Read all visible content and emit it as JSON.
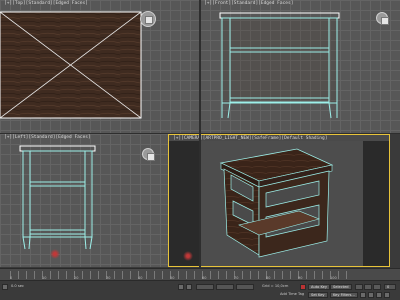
{
  "viewports": {
    "top": {
      "label": "[+][Top][Standard][Edged Faces]"
    },
    "front": {
      "label": "[+][Front][Standard][Edged Faces]"
    },
    "left": {
      "label": "[+][Left][Standard][Edged Faces]"
    },
    "perspective": {
      "label": "[+][CAMERA][ARTPRO_LIGHT_NEW][SafeFrame][Default Shading]"
    }
  },
  "timeline": {
    "ticks": [
      "0",
      "5",
      "10",
      "15",
      "20",
      "25",
      "30",
      "35",
      "40",
      "45",
      "50",
      "55",
      "60",
      "65",
      "70",
      "75",
      "80",
      "85",
      "90",
      "95",
      "100"
    ]
  },
  "status": {
    "grid": "Grid = 10,0cm",
    "autokey": "Auto Key",
    "selected": "Selected",
    "set_key": "Set Key",
    "key_filters": "Key Filters...",
    "add_time_tag": "Add Time Tag",
    "frame": "0",
    "mini_listener": "0.0 sec"
  },
  "colors": {
    "wood": "#3e2a1f",
    "wire": "#9df0ea",
    "active_border": "#e8c43a"
  }
}
